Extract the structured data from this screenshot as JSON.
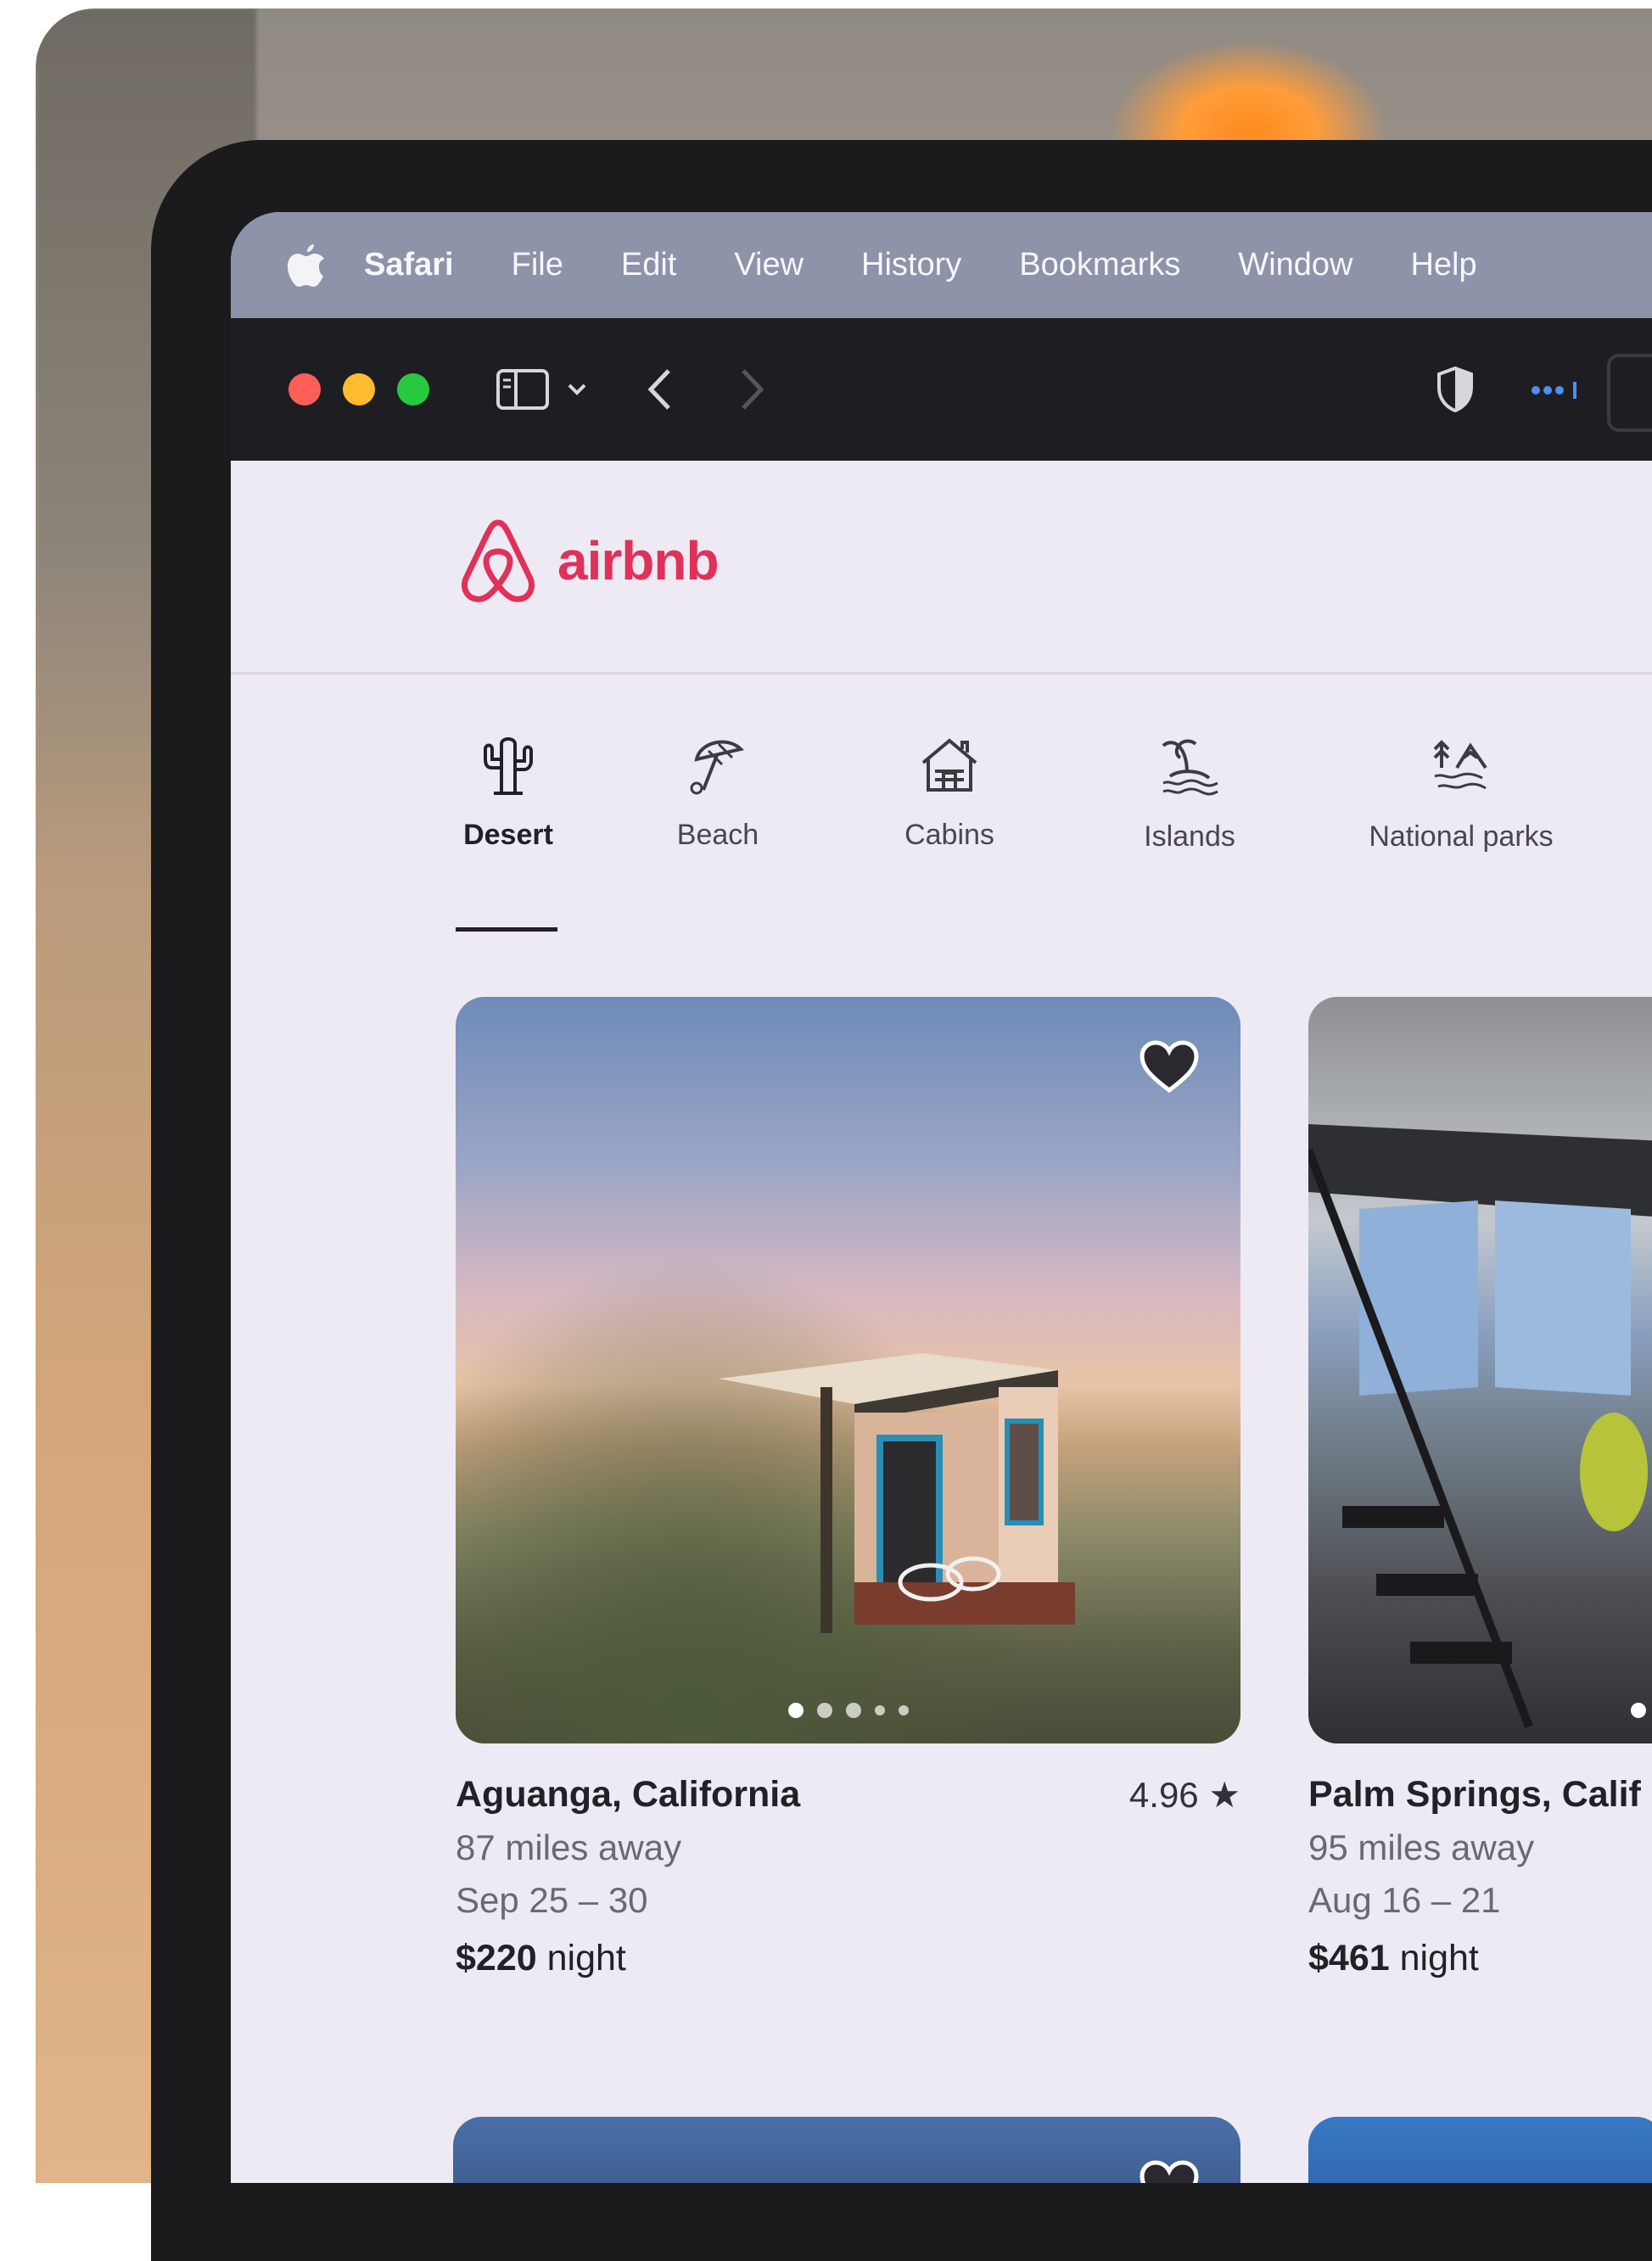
{
  "menubar": {
    "items": [
      "Safari",
      "File",
      "Edit",
      "View",
      "History",
      "Bookmarks",
      "Window",
      "Help"
    ]
  },
  "brand": {
    "name": "airbnb",
    "color": "#e0315a"
  },
  "categories": [
    {
      "label": "Desert",
      "icon": "cactus-icon",
      "active": true
    },
    {
      "label": "Beach",
      "icon": "umbrella-icon",
      "active": false
    },
    {
      "label": "Cabins",
      "icon": "cabin-icon",
      "active": false
    },
    {
      "label": "Islands",
      "icon": "island-icon",
      "active": false
    },
    {
      "label": "National parks",
      "icon": "mountain-icon",
      "active": false
    }
  ],
  "listings": [
    {
      "title": "Aguanga, California",
      "rating": "4.96 ★",
      "distance": "87 miles away",
      "dates": "Sep 25 – 30",
      "price": "$220",
      "price_unit": " night"
    },
    {
      "title": "Palm Springs, Calif",
      "distance": "95 miles away",
      "dates": "Aug 16 – 21",
      "price": "$461",
      "price_unit": " night"
    }
  ]
}
